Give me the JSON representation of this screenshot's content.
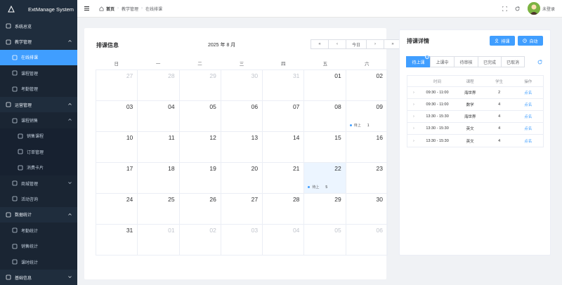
{
  "app": {
    "title": "ExtManage System"
  },
  "sidebar": {
    "items": [
      {
        "label": "系统总览",
        "level": 1,
        "icon": "home-icon",
        "expand": ""
      },
      {
        "label": "教学管理",
        "level": 1,
        "icon": "book-icon",
        "expand": "up"
      },
      {
        "label": "在线排课",
        "level": 2,
        "icon": "calendar-icon",
        "active": true
      },
      {
        "label": "课程管理",
        "level": 2,
        "icon": "course-icon"
      },
      {
        "label": "考勤管理",
        "level": 2,
        "icon": "attendance-icon"
      },
      {
        "label": "运营管理",
        "level": 1,
        "icon": "operation-icon",
        "expand": "up"
      },
      {
        "label": "课程销售",
        "level": 2,
        "icon": "sales-icon",
        "expand": "up"
      },
      {
        "label": "销售课程",
        "level": 3,
        "icon": "sell-course-icon"
      },
      {
        "label": "订单管理",
        "level": 3,
        "icon": "order-icon"
      },
      {
        "label": "消费卡片",
        "level": 3,
        "icon": "card-icon"
      },
      {
        "label": "商城管理",
        "level": 2,
        "icon": "shop-icon",
        "expand": "down"
      },
      {
        "label": "活动咨询",
        "level": 2,
        "icon": "activity-icon"
      },
      {
        "label": "数据统计",
        "level": 1,
        "icon": "chart-icon",
        "expand": "up"
      },
      {
        "label": "考勤统计",
        "level": 2,
        "icon": "attendance-stats-icon"
      },
      {
        "label": "销售统计",
        "level": 2,
        "icon": "sales-stats-icon"
      },
      {
        "label": "课时统计",
        "level": 2,
        "icon": "hours-stats-icon"
      },
      {
        "label": "基础信息",
        "level": 1,
        "icon": "user-icon",
        "expand": "down"
      }
    ]
  },
  "topbar": {
    "breadcrumb": [
      "首页",
      "教学管理",
      "在线排课"
    ],
    "user_label": "未登录"
  },
  "calendar": {
    "title": "排课信息",
    "month_label": "2025 年 8 月",
    "nav": {
      "prev_year": "«",
      "prev_month": "‹",
      "today": "今日",
      "next_month": "›",
      "next_year": "»"
    },
    "weekdays": [
      "日",
      "一",
      "二",
      "三",
      "四",
      "五",
      "六"
    ],
    "weeks": [
      [
        {
          "d": "27",
          "o": true
        },
        {
          "d": "28",
          "o": true
        },
        {
          "d": "29",
          "o": true
        },
        {
          "d": "30",
          "o": true
        },
        {
          "d": "31",
          "o": true
        },
        {
          "d": "01"
        },
        {
          "d": "02"
        }
      ],
      [
        {
          "d": "03"
        },
        {
          "d": "04"
        },
        {
          "d": "05"
        },
        {
          "d": "06"
        },
        {
          "d": "07"
        },
        {
          "d": "08"
        },
        {
          "d": "09",
          "event": {
            "label": "待上",
            "count": "1"
          }
        }
      ],
      [
        {
          "d": "10"
        },
        {
          "d": "11"
        },
        {
          "d": "12"
        },
        {
          "d": "13"
        },
        {
          "d": "14"
        },
        {
          "d": "15"
        },
        {
          "d": "16"
        }
      ],
      [
        {
          "d": "17"
        },
        {
          "d": "18"
        },
        {
          "d": "19"
        },
        {
          "d": "20"
        },
        {
          "d": "21"
        },
        {
          "d": "22",
          "selected": true,
          "event": {
            "label": "待上",
            "count": "5"
          }
        },
        {
          "d": "23"
        }
      ],
      [
        {
          "d": "24"
        },
        {
          "d": "25"
        },
        {
          "d": "26"
        },
        {
          "d": "27"
        },
        {
          "d": "28"
        },
        {
          "d": "29"
        },
        {
          "d": "30"
        }
      ],
      [
        {
          "d": "31"
        },
        {
          "d": "01",
          "o": true
        },
        {
          "d": "02",
          "o": true
        },
        {
          "d": "03",
          "o": true
        },
        {
          "d": "04",
          "o": true
        },
        {
          "d": "05",
          "o": true
        },
        {
          "d": "06",
          "o": true
        }
      ]
    ]
  },
  "detail": {
    "title": "排课详情",
    "arrange_label": "排课",
    "auto_label": "自动",
    "tabs": [
      {
        "label": "待上课",
        "active": true,
        "badge": "0",
        "width": 35
      },
      {
        "label": "上课中",
        "width": 35
      },
      {
        "label": "待审核",
        "width": 35
      },
      {
        "label": "已完成",
        "width": 34
      },
      {
        "label": "已取消",
        "width": 34
      }
    ],
    "columns": [
      "",
      "时间",
      "课程",
      "学生",
      "操作"
    ],
    "rows": [
      {
        "time": "09:30 - 11:00",
        "course": "海世界",
        "students": "2",
        "action": "点名"
      },
      {
        "time": "09:30 - 11:00",
        "course": "数学",
        "students": "4",
        "action": "点名"
      },
      {
        "time": "13:30 - 15:30",
        "course": "海世界",
        "students": "4",
        "action": "点名"
      },
      {
        "time": "13:30 - 15:30",
        "course": "英文",
        "students": "4",
        "action": "点名"
      },
      {
        "time": "13:30 - 15:30",
        "course": "英文",
        "students": "4",
        "action": "点名"
      }
    ]
  },
  "colors": {
    "primary": "#409eff",
    "sidebar_bg": "#1f2d3d",
    "page_bg": "#f0f2f5"
  }
}
